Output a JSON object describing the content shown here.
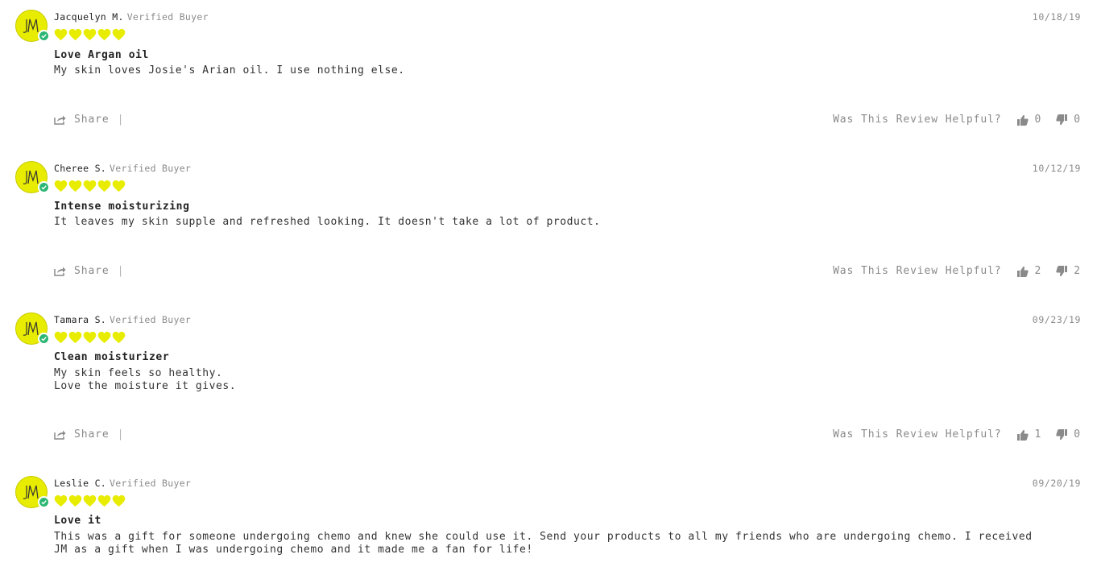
{
  "colors": {
    "heart": "#e8ec00",
    "avatar_bg": "#e8ec00",
    "verified_badge": "#2bb673",
    "muted_text": "#8a8a8a"
  },
  "icons": {
    "avatar": "jm-monogram-icon",
    "badge": "check-badge-icon",
    "rating": "heart-icon",
    "share": "share-icon",
    "helpful_up": "thumbs-up-icon",
    "helpful_down": "thumbs-down-icon"
  },
  "labels": {
    "verified": "Verified Buyer",
    "share": "Share",
    "separator": "|",
    "helpful_question": "Was This Review Helpful?"
  },
  "reviews": [
    {
      "name": "Jacquelyn M.",
      "date": "10/18/19",
      "rating": 5,
      "title": "Love Argan oil",
      "body_lines": [
        "My skin loves Josie's Arian oil. I use nothing else."
      ],
      "helpful_yes": "0",
      "helpful_no": "0"
    },
    {
      "name": "Cheree S.",
      "date": "10/12/19",
      "rating": 5,
      "title": "Intense moisturizing",
      "body_lines": [
        "It leaves my skin supple and refreshed looking. It doesn't take a lot of product."
      ],
      "helpful_yes": "2",
      "helpful_no": "2"
    },
    {
      "name": "Tamara S.",
      "date": "09/23/19",
      "rating": 5,
      "title": "Clean moisturizer",
      "body_lines": [
        "My skin feels so healthy.",
        "Love the moisture it gives."
      ],
      "helpful_yes": "1",
      "helpful_no": "0"
    },
    {
      "name": "Leslie C.",
      "date": "09/20/19",
      "rating": 5,
      "title": "Love it",
      "body_lines": [
        "This was a gift for someone undergoing chemo and knew she could use it. Send your products to all my friends who are undergoing chemo. I received",
        "JM as a gift when I was undergoing chemo and it made me a fan for life!"
      ]
    }
  ]
}
